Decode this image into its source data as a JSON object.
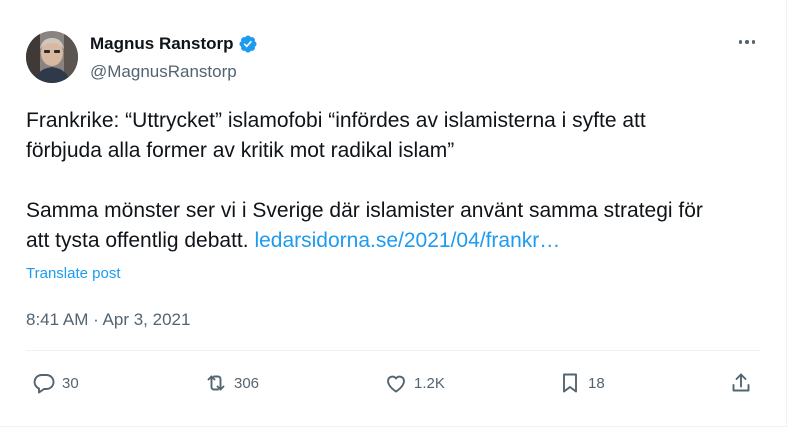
{
  "author": {
    "name": "Magnus Ranstorp",
    "handle": "@MagnusRanstorp",
    "verified": true
  },
  "post": {
    "paragraph1": "Frankrike: “Uttrycket” islamofobi “infördes av islamisterna i syfte att förbjuda alla former av kritik mot radikal islam”",
    "paragraph2": "Samma mönster ser vi i Sverige där islamister använt samma strategi för att tysta offentlig debatt.",
    "link_text": "ledarsidorna.se/2021/04/frankr…",
    "translate_label": "Translate post",
    "timestamp": "8:41 AM · Apr 3, 2021"
  },
  "actions": {
    "replies": "30",
    "reposts": "306",
    "likes": "1.2K",
    "bookmarks": "18"
  },
  "colors": {
    "link": "#1d9bf0",
    "verified": "#1d9bf0",
    "secondary_text": "#536471",
    "primary_text": "#0f1419"
  },
  "icons": [
    "more-icon",
    "verified-badge-icon",
    "reply-icon",
    "repost-icon",
    "like-icon",
    "bookmark-icon",
    "share-icon"
  ]
}
